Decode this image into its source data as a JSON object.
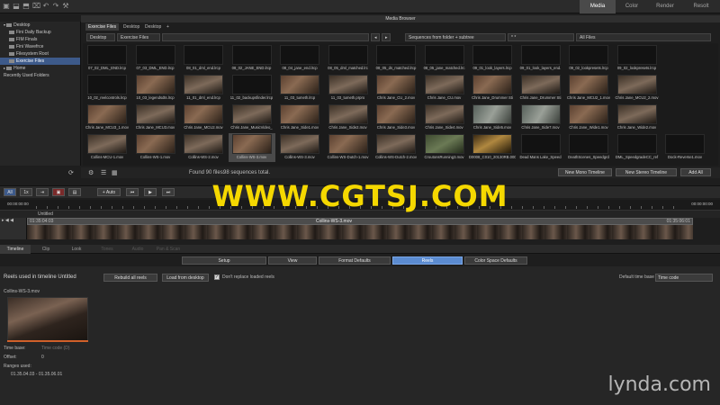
{
  "mode_tabs": [
    {
      "label": "Media",
      "active": true
    },
    {
      "label": "Color",
      "active": false
    },
    {
      "label": "Render",
      "active": false
    },
    {
      "label": "Resolt",
      "active": false
    }
  ],
  "tree": {
    "items": [
      {
        "label": "Desktop",
        "level": 0,
        "selected": false
      },
      {
        "label": "Fini Daily Backup",
        "level": 1,
        "selected": false
      },
      {
        "label": "FIM Finals",
        "level": 1,
        "selected": false
      },
      {
        "label": "Fini Wavefrce",
        "level": 1,
        "selected": false
      },
      {
        "label": "Filesystem Root",
        "level": 1,
        "selected": false
      },
      {
        "label": "Exercise Files",
        "level": 1,
        "selected": true
      },
      {
        "label": "Home",
        "level": 0,
        "selected": false
      },
      {
        "label": "Recently Used Folders",
        "level": 0,
        "selected": false
      }
    ]
  },
  "media_browser": {
    "title": "Media Browser",
    "tabs": [
      {
        "label": "Exercise Files",
        "active": true
      },
      {
        "label": "Desktop",
        "active": false
      },
      {
        "label": "Desktop",
        "active": false
      },
      {
        "label": "+",
        "active": false
      }
    ],
    "path": {
      "crumb1": "Desktop",
      "crumb2": "Exercise Files",
      "sequences": "Sequences from folder + subtree",
      "search": "* *",
      "filter": "All Files"
    },
    "rows": [
      [
        {
          "name": "07_02_DML_END.lrcp",
          "t": "none"
        },
        {
          "name": "07_03_DML_END.lrcp",
          "t": "none"
        },
        {
          "name": "08_01_dml_end.lrcp",
          "t": "none"
        },
        {
          "name": "08_02_JANE_END.lrcp",
          "t": "none"
        },
        {
          "name": "08_04_jane_end.lrcp",
          "t": "none"
        },
        {
          "name": "08_05_dml_matched.lrc",
          "t": "none"
        },
        {
          "name": "08_05_ds_matched.lrcp",
          "t": "none"
        },
        {
          "name": "08_05_jane_matched.lrc",
          "t": "none"
        },
        {
          "name": "09_01_look_layers.lrcp",
          "t": "none"
        },
        {
          "name": "09_01_look_layers_end.",
          "t": "none"
        },
        {
          "name": "09_02_lookpresets.lrcp",
          "t": "none"
        },
        {
          "name": "09_02_lookpresets.lrcp",
          "t": "none"
        }
      ],
      [
        {
          "name": "10_02_reelcontrols.lrcp",
          "t": "none"
        },
        {
          "name": "10_03_legendsdts.lrcp",
          "t": "img"
        },
        {
          "name": "11_01_dml_end.lrcp",
          "t": "img b"
        },
        {
          "name": "11_02_backupsfinder.lrcp",
          "t": "none"
        },
        {
          "name": "11_03_tumeth.lrcp",
          "t": "img"
        },
        {
          "name": "11_03_tumeth.prpro",
          "t": "img b"
        },
        {
          "name": "Chris Jane_CU_2.mov",
          "t": "img"
        },
        {
          "name": "Chris Jane_CU.mov",
          "t": "img b"
        },
        {
          "name": "Chris Jane_Drummer Sti",
          "t": "img"
        },
        {
          "name": "Chris Jane_Drummer Sti",
          "t": "img b"
        },
        {
          "name": "Chris Jane_MCU2_1.mov",
          "t": "img"
        },
        {
          "name": "Chris Jane_MCU2_2.mov",
          "t": "img b"
        }
      ],
      [
        {
          "name": "Chris Jane_MCU3_1.mov",
          "t": "img"
        },
        {
          "name": "Chris Jane_MCU3.mov",
          "t": "img b"
        },
        {
          "name": "Chris Jane_MCU2.mov",
          "t": "img"
        },
        {
          "name": "Chris Jane_MusicVideo_",
          "t": "img b"
        },
        {
          "name": "Chris Jane_Side1.mov",
          "t": "img"
        },
        {
          "name": "Chris Jane_Side2.mov",
          "t": "img b"
        },
        {
          "name": "Chris Jane_Side3.mov",
          "t": "img"
        },
        {
          "name": "Chris Jane_Side4.mov",
          "t": "img b"
        },
        {
          "name": "Chris Jane_Side5.mov",
          "t": "img c"
        },
        {
          "name": "Chris Jane_Side7.mov",
          "t": "img c"
        },
        {
          "name": "Chris Jane_Wide1.mov",
          "t": "img"
        },
        {
          "name": "Chris Jane_Wide2.mov",
          "t": "img b"
        }
      ],
      [
        {
          "name": "Collins-MCU-1.mov",
          "t": "img b"
        },
        {
          "name": "Collins-WS-1.mov",
          "t": "img"
        },
        {
          "name": "Collins-WS-2.mov",
          "t": "img b"
        },
        {
          "name": "Collins-WS-3.mov",
          "t": "img",
          "sel": true
        },
        {
          "name": "Collins-WS-3.mov",
          "t": "img b"
        },
        {
          "name": "Collins-WS-Dutch-1.mov",
          "t": "img"
        },
        {
          "name": "Collins-WS-Dutch-2.mov",
          "t": "img b"
        },
        {
          "name": "CroutonsRunning3.mov",
          "t": "img d"
        },
        {
          "name": "D0008_C010_20130RB.000",
          "t": "img e"
        },
        {
          "name": "Dead Mans Lake_Speed",
          "t": "none"
        },
        {
          "name": "DeathScenes_Speedgrd",
          "t": "none"
        },
        {
          "name": "DML_SpeedgradeCC_ref",
          "t": "none"
        },
        {
          "name": "Dock-Reverse1.mov",
          "t": "none"
        }
      ]
    ],
    "found": "Found 90 files.",
    "sequences_total": "98 sequences total.",
    "new_mono": "New Mono Timeline",
    "new_stereo": "New Stereo Timeline",
    "add_all": "Add All"
  },
  "transport": {
    "all": "All",
    "auto": "+ Auto"
  },
  "ruler": {
    "start": "00:00:00:00",
    "end": "00:00:00:00"
  },
  "timeline": {
    "name": "Untitled",
    "clip_name": "Collins-WS-3.mov",
    "tc_left": "00:00:00:00",
    "tc_in": "01:35:04:03",
    "tc_out": "01:35:06:01"
  },
  "bottom_tabs": [
    {
      "label": "Timeline",
      "active": true
    },
    {
      "label": "Clip",
      "active": false
    },
    {
      "label": "Look",
      "active": false
    },
    {
      "label": "Tones",
      "active": false
    },
    {
      "label": "Audio",
      "active": false
    },
    {
      "label": "Pan & Scan",
      "active": false
    }
  ],
  "settings_tabs": [
    {
      "label": "Setup",
      "active": false
    },
    {
      "label": "View",
      "active": false
    },
    {
      "label": "Format Defaults",
      "active": false
    },
    {
      "label": "Reels",
      "active": true
    },
    {
      "label": "Color Space Defaults",
      "active": false
    }
  ],
  "reels": {
    "heading": "Reels used in timeline Untitled",
    "rebuild": "Rebuild all reels",
    "load": "Load from desktop",
    "dont_replace": "Don't replace loaded reels",
    "default_time_base_label": "Default time base",
    "default_time_base_value": "Time code",
    "clip_name": "Collins-WS-3.mov",
    "time_base_label": "Time base:",
    "time_base_value": "Time code (D)",
    "offset_label": "Offset:",
    "offset_value": "0",
    "ranges_label": "Ranges used:",
    "ranges_value": "01.35.04.03 - 01.35.06.01"
  },
  "watermark": "WWW.CGTSJ.COM",
  "brand": "lynda.com"
}
